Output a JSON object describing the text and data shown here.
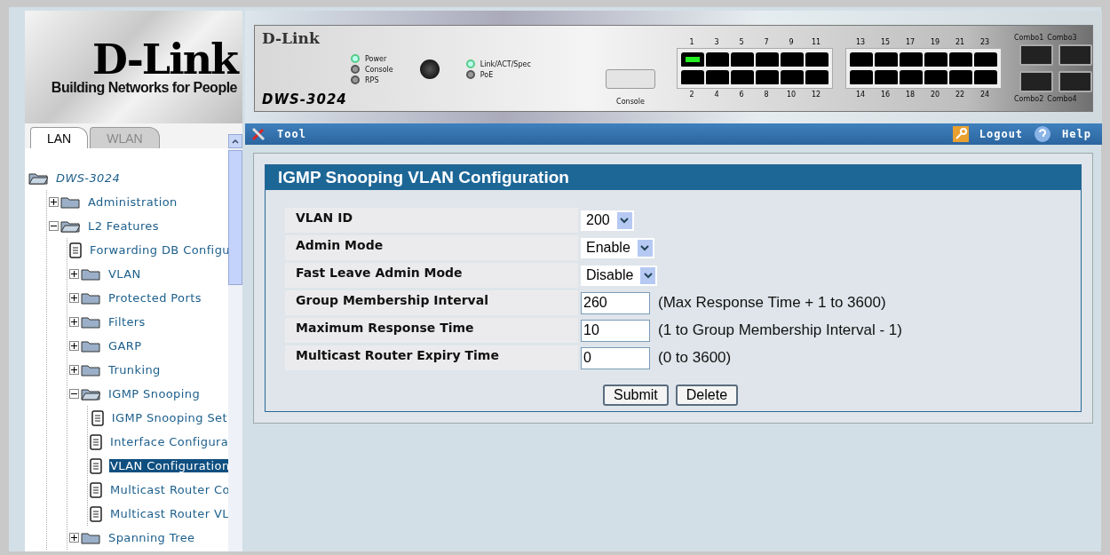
{
  "logo": {
    "brand": "D-Link",
    "tagline": "Building Networks for People"
  },
  "device": {
    "brand": "D-Link",
    "model": "DWS-3024",
    "console_label": "Console",
    "leds": [
      {
        "label": "Power",
        "on": true
      },
      {
        "label": "Console",
        "on": false
      },
      {
        "label": "RPS",
        "on": false
      }
    ],
    "leds_right": [
      {
        "label": "Link/ACT/Spec",
        "on": true
      },
      {
        "label": "PoE",
        "on": false
      }
    ],
    "ports": [
      {
        "number": "1",
        "linked": true
      },
      {
        "number": "2",
        "linked": false
      },
      {
        "number": "3",
        "linked": false
      },
      {
        "number": "4",
        "linked": false
      },
      {
        "number": "5",
        "linked": false
      },
      {
        "number": "6",
        "linked": false
      },
      {
        "number": "7",
        "linked": false
      },
      {
        "number": "8",
        "linked": false
      },
      {
        "number": "9",
        "linked": false
      },
      {
        "number": "10",
        "linked": false
      },
      {
        "number": "11",
        "linked": false
      },
      {
        "number": "12",
        "linked": false
      },
      {
        "number": "13",
        "linked": false
      },
      {
        "number": "14",
        "linked": false
      },
      {
        "number": "15",
        "linked": false
      },
      {
        "number": "16",
        "linked": false
      },
      {
        "number": "17",
        "linked": false
      },
      {
        "number": "18",
        "linked": false
      },
      {
        "number": "19",
        "linked": false
      },
      {
        "number": "20",
        "linked": false
      },
      {
        "number": "21",
        "linked": false
      },
      {
        "number": "22",
        "linked": false
      },
      {
        "number": "23",
        "linked": false
      },
      {
        "number": "24",
        "linked": false
      }
    ],
    "combos": [
      "Combo1",
      "Combo2",
      "Combo3",
      "Combo4"
    ]
  },
  "tabs": [
    {
      "label": "LAN",
      "selected": true
    },
    {
      "label": "WLAN",
      "selected": false
    }
  ],
  "toolbar": {
    "tool": "Tool",
    "logout": "Logout",
    "help": "Help"
  },
  "tree": {
    "label": "DWS-3024",
    "kind": "root",
    "children": [
      {
        "label": "Administration",
        "kind": "folder",
        "expanded": false
      },
      {
        "label": "L2 Features",
        "kind": "folder",
        "expanded": true,
        "children": [
          {
            "label": "Forwarding DB Configu",
            "kind": "page",
            "selected": false
          },
          {
            "label": "VLAN",
            "kind": "folder",
            "expanded": false
          },
          {
            "label": "Protected Ports",
            "kind": "folder",
            "expanded": false
          },
          {
            "label": "Filters",
            "kind": "folder",
            "expanded": false
          },
          {
            "label": "GARP",
            "kind": "folder",
            "expanded": false
          },
          {
            "label": "Trunking",
            "kind": "folder",
            "expanded": false
          },
          {
            "label": "IGMP Snooping",
            "kind": "folder",
            "expanded": true,
            "children": [
              {
                "label": "IGMP Snooping Set",
                "kind": "page",
                "selected": false
              },
              {
                "label": "Interface Configura",
                "kind": "page",
                "selected": false
              },
              {
                "label": "VLAN Configuration",
                "kind": "page",
                "selected": true
              },
              {
                "label": "Multicast Router Co",
                "kind": "page",
                "selected": false
              },
              {
                "label": "Multicast Router VL",
                "kind": "page",
                "selected": false
              }
            ]
          },
          {
            "label": "Spanning Tree",
            "kind": "folder",
            "expanded": false
          }
        ]
      }
    ]
  },
  "form": {
    "title": "IGMP Snooping VLAN Configuration",
    "fields": [
      {
        "label": "VLAN ID",
        "kind": "select",
        "value": "200"
      },
      {
        "label": "Admin Mode",
        "kind": "select",
        "value": "Enable"
      },
      {
        "label": "Fast Leave Admin Mode",
        "kind": "select",
        "value": "Disable"
      },
      {
        "label": "Group Membership Interval",
        "kind": "text",
        "value": "260",
        "hint": "(Max Response Time + 1 to 3600)"
      },
      {
        "label": "Maximum Response Time",
        "kind": "text",
        "value": "10",
        "hint": "(1 to Group Membership Interval - 1)"
      },
      {
        "label": "Multicast Router Expiry Time",
        "kind": "text",
        "value": "0",
        "hint": "(0 to 3600)"
      }
    ],
    "buttons": [
      "Submit",
      "Delete"
    ]
  }
}
